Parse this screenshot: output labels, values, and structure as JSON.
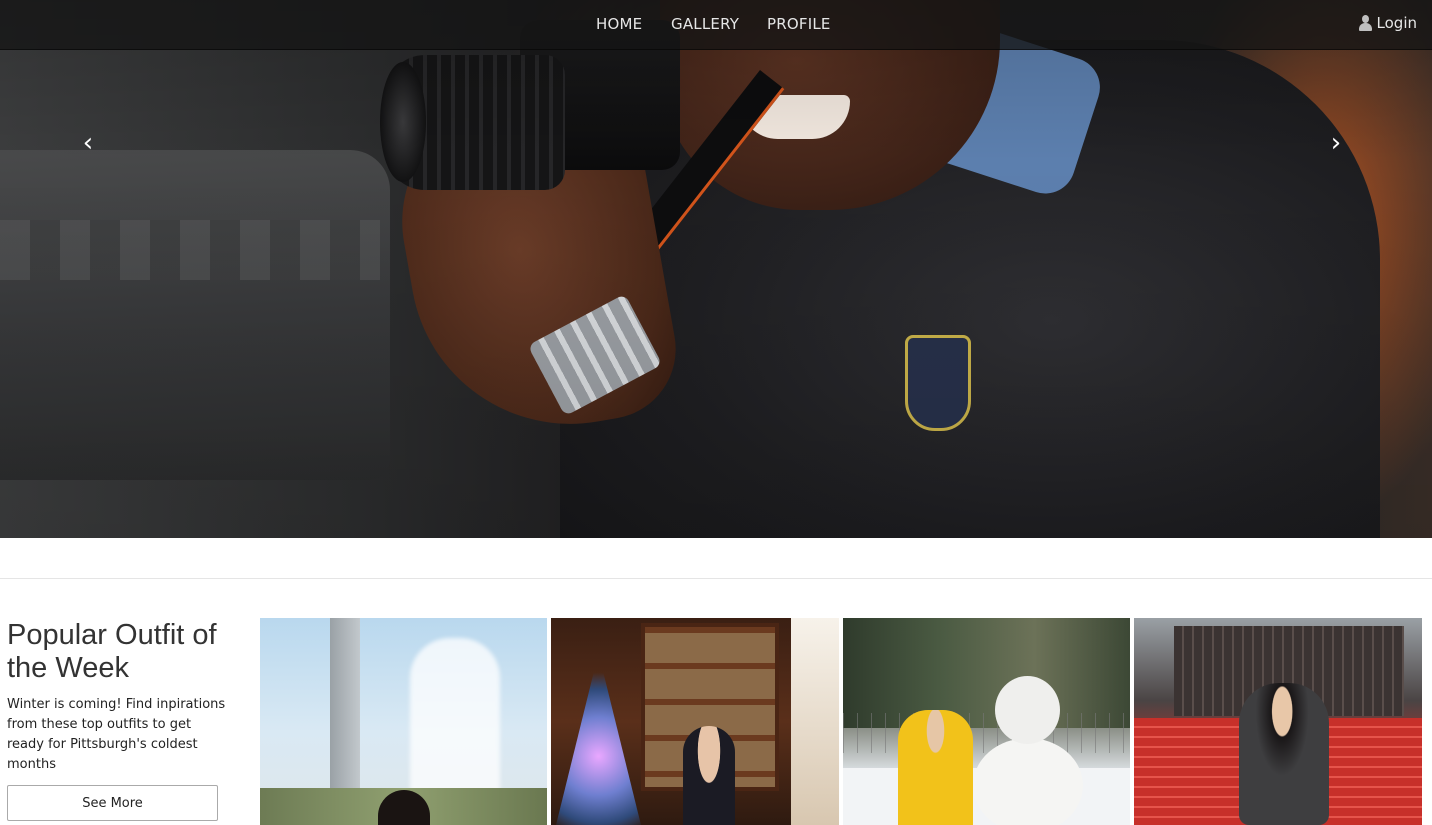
{
  "navbar": {
    "links": [
      {
        "label": "HOME"
      },
      {
        "label": "GALLERY"
      },
      {
        "label": "PROFILE"
      }
    ],
    "login_label": "Login",
    "login_icon": "user-icon"
  },
  "carousel": {
    "prev_icon": "chevron-left-icon",
    "next_icon": "chevron-right-icon",
    "prev_glyph": "‹",
    "next_glyph": "›"
  },
  "popular": {
    "title": "Popular Outfit of the Week",
    "description": "Winter is coming! Find inpirations from these top outfits to get ready for Pittsburgh's coldest months",
    "button_label": "See More"
  },
  "colors": {
    "navbar_bg": "#141414",
    "text_dark": "#333333",
    "nav_text": "#e6e6e6"
  }
}
